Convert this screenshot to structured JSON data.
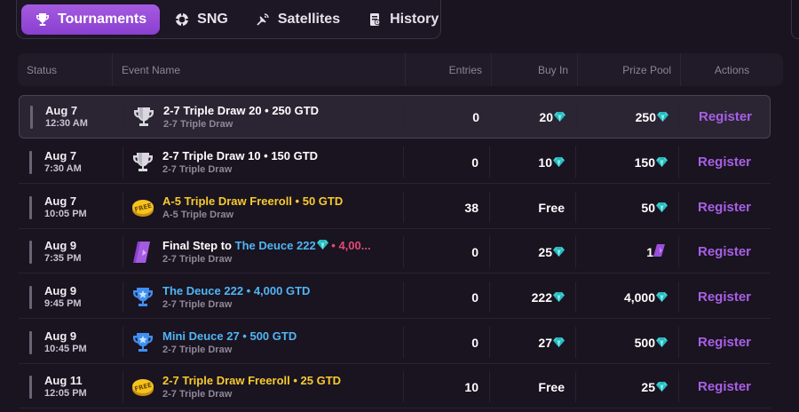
{
  "tabs": [
    {
      "label": "Tournaments",
      "icon": "trophy-icon",
      "active": true
    },
    {
      "label": "SNG",
      "icon": "chip-icon",
      "active": false
    },
    {
      "label": "Satellites",
      "icon": "satellite-icon",
      "active": false
    },
    {
      "label": "History",
      "icon": "history-icon",
      "active": false
    }
  ],
  "headers": {
    "status": "Status",
    "event": "Event Name",
    "entries": "Entries",
    "buyin": "Buy In",
    "prize": "Prize Pool",
    "actions": "Actions"
  },
  "colors": {
    "accent": "#9b4fdc",
    "register": "#a760e6",
    "freeroll": "#f6cb2e",
    "deuce": "#4fb6f4",
    "gem": "#3ad6d2"
  },
  "rows": [
    {
      "date": "Aug 7",
      "time": "12:30 AM",
      "icon": "silver-trophy-icon",
      "name_prefix": "",
      "name_main": "2-7 Triple Draw 20 • 250 GTD",
      "name_color": "white",
      "name_suffix": "",
      "sub": "2-7 Triple Draw",
      "entries": "0",
      "buyin": "20",
      "buyin_gem": true,
      "prize": "250",
      "prize_icon": "gem",
      "action": "Register"
    },
    {
      "date": "Aug 7",
      "time": "7:30 AM",
      "icon": "silver-trophy-icon",
      "name_prefix": "",
      "name_main": "2-7 Triple Draw 10 • 150 GTD",
      "name_color": "white",
      "name_suffix": "",
      "sub": "2-7 Triple Draw",
      "entries": "0",
      "buyin": "10",
      "buyin_gem": true,
      "prize": "150",
      "prize_icon": "gem",
      "action": "Register"
    },
    {
      "date": "Aug 7",
      "time": "10:05 PM",
      "icon": "free-coin-icon",
      "name_prefix": "",
      "name_main": "A-5 Triple Draw Freeroll • 50 GTD",
      "name_color": "yellow",
      "name_suffix": "",
      "sub": "A-5 Triple Draw",
      "entries": "38",
      "buyin": "Free",
      "buyin_gem": false,
      "prize": "50",
      "prize_icon": "gem",
      "action": "Register"
    },
    {
      "date": "Aug 9",
      "time": "7:35 PM",
      "icon": "ticket-icon",
      "name_prefix": "Final Step to ",
      "name_main": "The Deuce 222",
      "name_color": "blue",
      "name_suffix": " • 4,00...",
      "sub": "2-7 Triple Draw",
      "entries": "0",
      "buyin": "25",
      "buyin_gem": true,
      "prize": "1",
      "prize_icon": "ticket",
      "action": "Register"
    },
    {
      "date": "Aug 9",
      "time": "9:45 PM",
      "icon": "blue-trophy-icon",
      "name_prefix": "",
      "name_main": "The Deuce 222 • 4,000 GTD",
      "name_color": "blue",
      "name_suffix": "",
      "sub": "2-7 Triple Draw",
      "entries": "0",
      "buyin": "222",
      "buyin_gem": true,
      "prize": "4,000",
      "prize_icon": "gem",
      "action": "Register"
    },
    {
      "date": "Aug 9",
      "time": "10:45 PM",
      "icon": "blue-trophy-icon",
      "name_prefix": "",
      "name_main": "Mini Deuce 27 • 500 GTD",
      "name_color": "blue",
      "name_suffix": "",
      "sub": "2-7 Triple Draw",
      "entries": "0",
      "buyin": "27",
      "buyin_gem": true,
      "prize": "500",
      "prize_icon": "gem",
      "action": "Register"
    },
    {
      "date": "Aug 11",
      "time": "12:05 PM",
      "icon": "free-coin-icon",
      "name_prefix": "",
      "name_main": "2-7 Triple Draw Freeroll • 25 GTD",
      "name_color": "yellow",
      "name_suffix": "",
      "sub": "2-7 Triple Draw",
      "entries": "10",
      "buyin": "Free",
      "buyin_gem": false,
      "prize": "25",
      "prize_icon": "gem",
      "action": "Register"
    }
  ]
}
